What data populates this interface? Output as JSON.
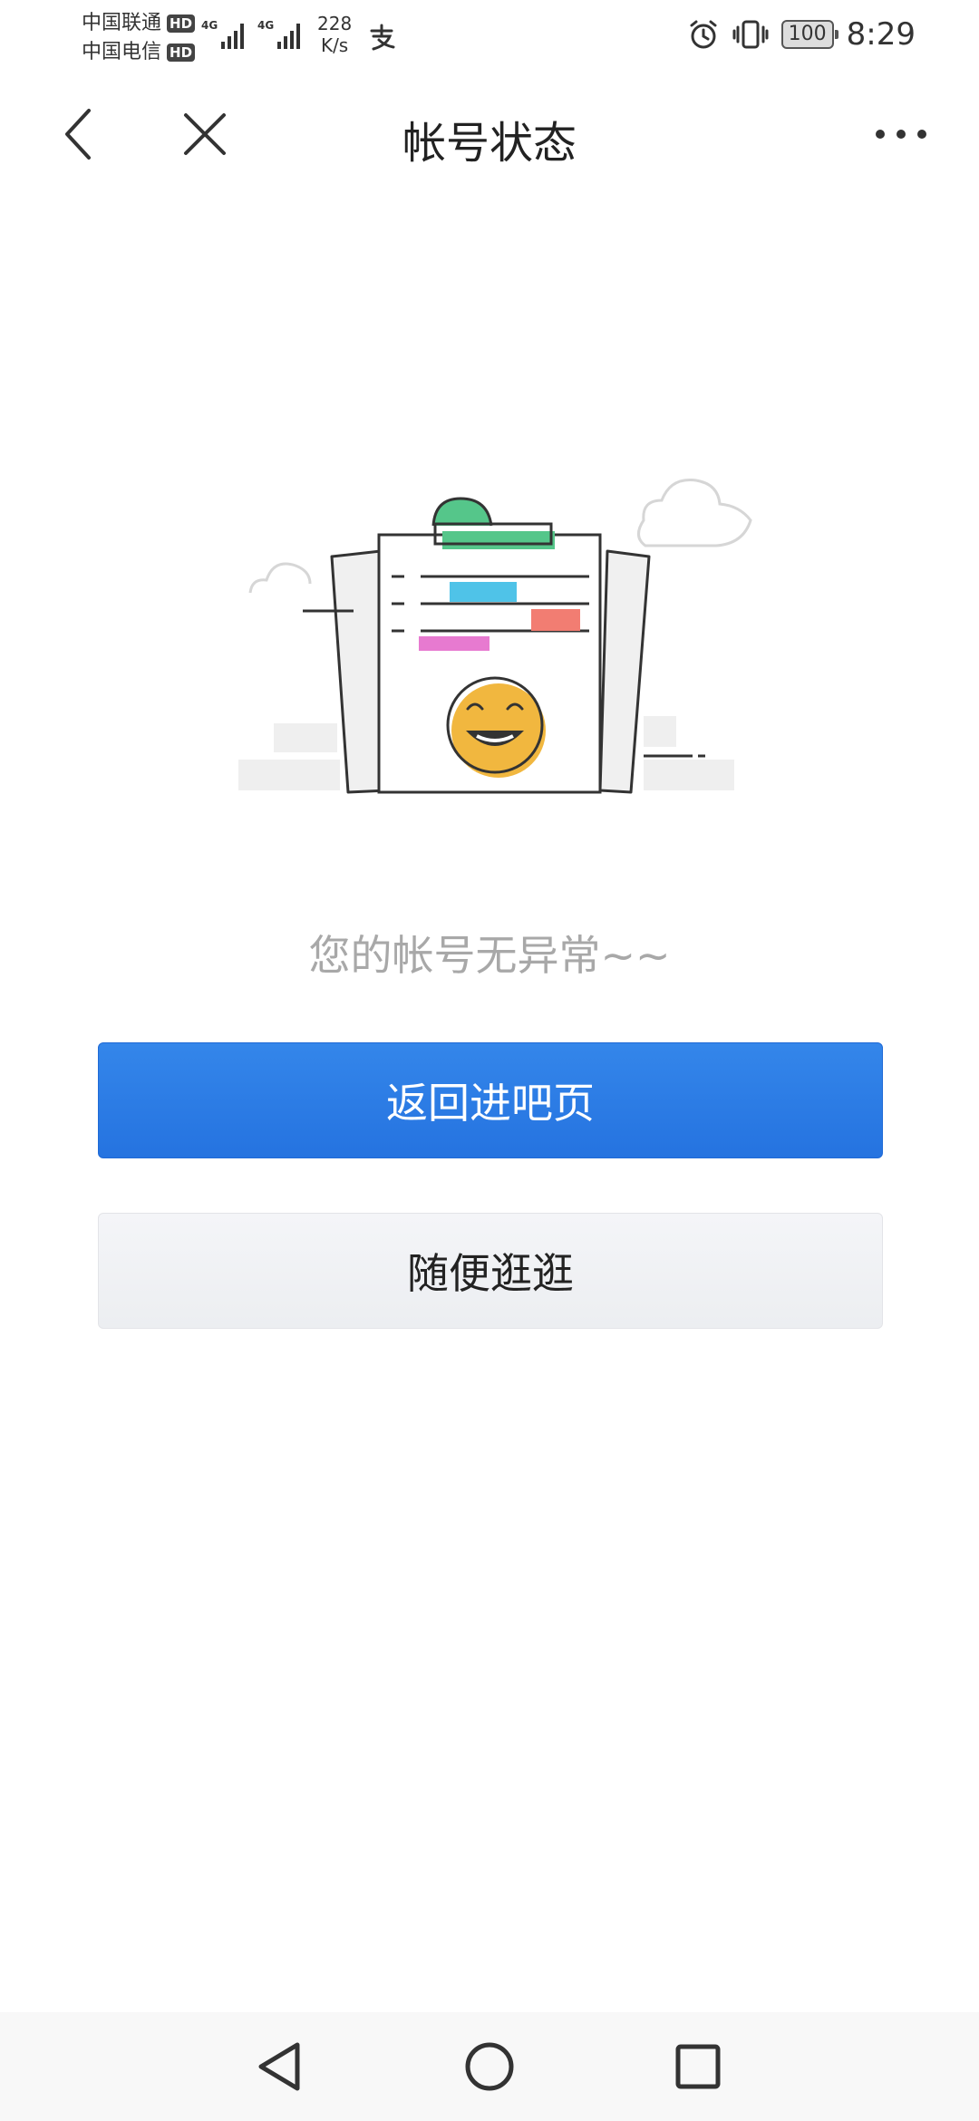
{
  "status_bar": {
    "carrier1": "中国联通",
    "carrier2": "中国电信",
    "hd": "HD",
    "network": "4G",
    "speed_value": "228",
    "speed_unit": "K/s",
    "battery": "100",
    "time": "8:29",
    "icons": [
      "alipay-icon",
      "alarm-icon",
      "vibrate-icon",
      "battery-icon"
    ]
  },
  "nav": {
    "title": "帐号状态",
    "back_icon": "chevron-left-icon",
    "close_icon": "close-icon",
    "more_icon": "more-dots-icon"
  },
  "main": {
    "message": "您的帐号无异常~~",
    "primary_button": "返回进吧页",
    "secondary_button": "随便逛逛"
  },
  "colors": {
    "primary": "#2a7ce6",
    "message_gray": "#a8a8a8",
    "secondary_bg": "#f0f1f4"
  },
  "system_nav": {
    "icons": [
      "back-triangle-icon",
      "home-circle-icon",
      "recents-square-icon"
    ]
  }
}
